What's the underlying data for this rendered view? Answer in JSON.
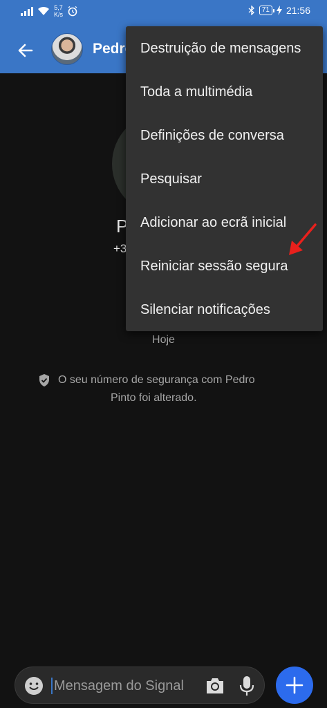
{
  "status_bar": {
    "speed_value": "5,7",
    "speed_unit": "K/s",
    "battery": "71",
    "time": "21:56",
    "icons": [
      "signal-icon",
      "wifi-icon",
      "alarm-icon",
      "bluetooth-icon",
      "battery-icon",
      "charging-icon"
    ]
  },
  "app_bar": {
    "contact_name": "Pedro",
    "accent_color": "#3a76c6"
  },
  "conversation": {
    "header_name": "P",
    "header_phone": "+3",
    "date_label": "Hoje",
    "safety_line1": "O seu número de segurança com Pedro",
    "safety_line2": "Pinto foi alterado."
  },
  "menu": {
    "items": [
      {
        "label": "Destruição de mensagens"
      },
      {
        "label": "Toda a multimédia"
      },
      {
        "label": "Definições de conversa"
      },
      {
        "label": "Pesquisar"
      },
      {
        "label": "Adicionar ao ecrã inicial"
      },
      {
        "label": "Reiniciar sessão segura"
      },
      {
        "label": "Silenciar notificações"
      }
    ]
  },
  "composer": {
    "placeholder": "Mensagem do Signal",
    "send_color": "#2c6bed"
  }
}
